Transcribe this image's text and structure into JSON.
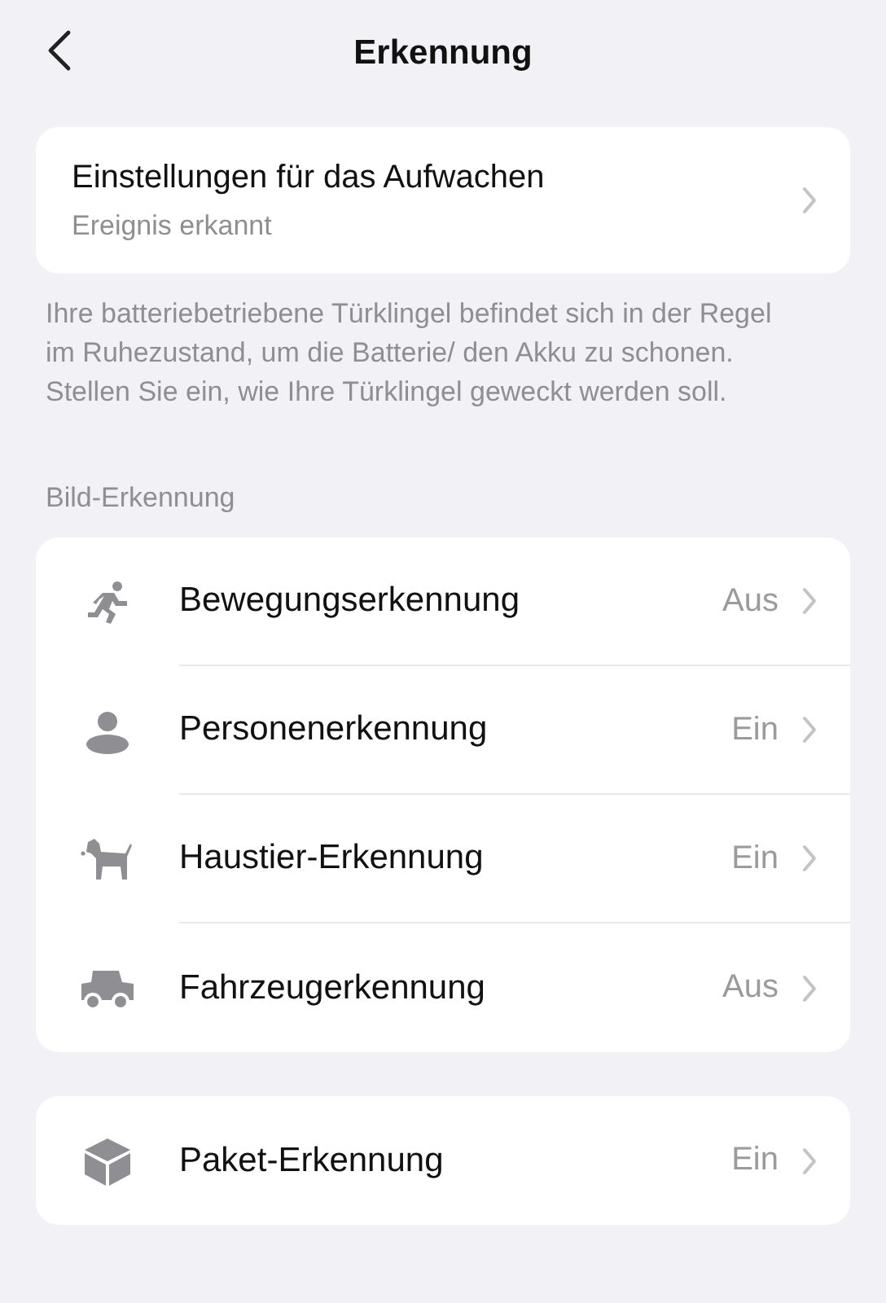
{
  "header": {
    "title": "Erkennung"
  },
  "wake_card": {
    "title": "Einstellungen für das Aufwachen",
    "subtitle": "Ereignis erkannt"
  },
  "description": "Ihre batteriebetriebene Türklingel befindet sich in der Regel im Ruhezustand, um die Batterie/ den Akku zu schonen. Stellen Sie ein, wie Ihre Türklingel geweckt werden soll.",
  "section_label": "Bild-Erkennung",
  "groups": [
    {
      "items": [
        {
          "kind": "motion",
          "label": "Bewegungserkennung",
          "value": "Aus"
        },
        {
          "kind": "person",
          "label": "Personenerkennung",
          "value": "Ein"
        },
        {
          "kind": "pet",
          "label": "Haustier-Erkennung",
          "value": "Ein"
        },
        {
          "kind": "vehicle",
          "label": "Fahrzeugerkennung",
          "value": "Aus"
        }
      ]
    },
    {
      "items": [
        {
          "kind": "package",
          "label": "Paket-Erkennung",
          "value": "Ein"
        }
      ]
    }
  ]
}
